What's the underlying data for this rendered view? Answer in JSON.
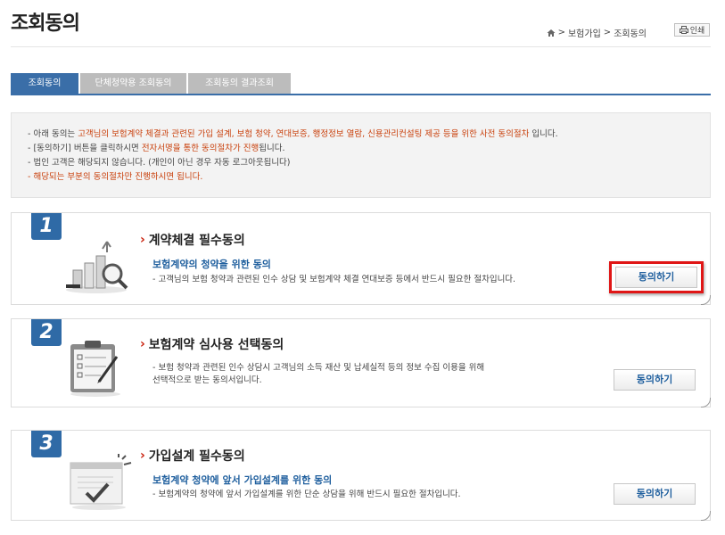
{
  "page_title": "조회동의",
  "breadcrumb": {
    "items": [
      "보험가입",
      "조회동의"
    ],
    "separator": ">"
  },
  "print_button": {
    "label": "인쇄"
  },
  "tabs": [
    {
      "label": "조회동의",
      "active": true
    },
    {
      "label": "단체청약용 조회동의",
      "active": false
    },
    {
      "label": "조회동의 결과조회",
      "active": false
    }
  ],
  "notice": {
    "line1": {
      "prefix": "-  아래 동의는 ",
      "red": "고객님의 보험계약 체결과 관련된 가입 설계, 보험 청약, 연대보증, 행정정보 열람, 신용관리컨설팅 제공 등을 위한 사전 동의절차",
      "suffix": " 입니다."
    },
    "line2": {
      "prefix": "-  [동의하기] 버튼을 클릭하시면 ",
      "red": "전자서명을 통한 동의절차가 진행",
      "suffix": "됩니다."
    },
    "line3": {
      "text": "-  법인 고객은 해당되지 않습니다. (개인이 아닌 경우 자동 로그아웃됩니다)"
    },
    "line4": {
      "red": "-  해당되는 부분의 동의절차만 진행하시면 됩니다."
    }
  },
  "steps": [
    {
      "number": "1",
      "title": "계약체결 필수동의",
      "subtitle": "보험계약의 청약을 위한 동의",
      "desc": [
        "-  고객님의 보험 청약과 관련된 인수 상담 및 보험계약 체결 연대보증 등에서 반드시 필요한 절차입니다."
      ],
      "button": "동의하기",
      "highlighted": true
    },
    {
      "number": "2",
      "title": "보험계약 심사용 선택동의",
      "subtitle": "",
      "desc": [
        "-  보험 청약과 관련된 인수 상담시 고객님의 소득 재산 및 납세실적 등의 정보 수집 이용을 위해",
        "    선택적으로 받는 동의서입니다."
      ],
      "button": "동의하기",
      "highlighted": false
    },
    {
      "number": "3",
      "title": "가입설계 필수동의",
      "subtitle": "보험계약 청약에 앞서 가입설계를 위한 동의",
      "desc": [
        "-  보험계약의 청약에 앞서 가입설계를 위한 단순 상담을 위해 반드시 필요한 절차입니다."
      ],
      "button": "동의하기",
      "highlighted": false
    }
  ],
  "icons": {
    "home": "home-icon",
    "print": "printer-icon",
    "chevron": "chevron-right-icon",
    "step1": "magnifier-chart-illustration",
    "step2": "clipboard-checklist-illustration",
    "step3": "browser-window-illustration"
  },
  "colors": {
    "accent_blue": "#2f6aa6",
    "link_blue": "#1f5f9e",
    "notice_red": "#c9400c",
    "highlight_red": "#e01616"
  }
}
